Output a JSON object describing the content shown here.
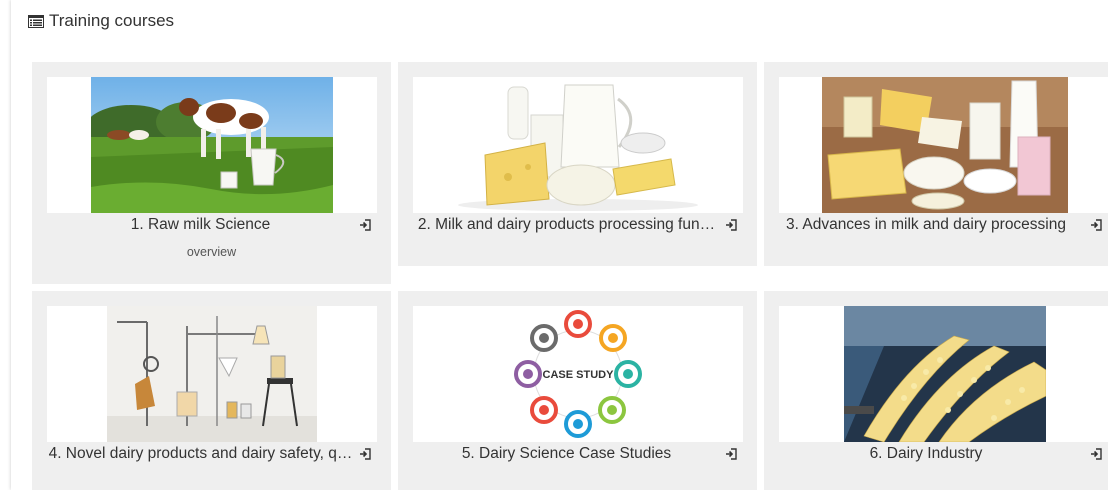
{
  "header": {
    "title": "Training courses",
    "icon": "list-icon"
  },
  "courses": [
    {
      "title": "1. Raw milk Science",
      "link": "overview"
    },
    {
      "title": "2. Milk and dairy products processing fun…"
    },
    {
      "title": "3. Advances in milk and dairy processing"
    },
    {
      "title": "4. Novel dairy products and dairy safety, q…"
    },
    {
      "title": "5. Dairy Science Case Studies"
    },
    {
      "title": "6. Dairy Industry"
    }
  ],
  "case_study": {
    "center_label": "CASE STUDY"
  },
  "colors": {
    "card_bg": "#efefef",
    "text": "#333333",
    "ring_colors": [
      "#e94b3c",
      "#f5a623",
      "#2bb3a3",
      "#8cc63f",
      "#1e9bd7",
      "#e94b3c",
      "#8e5ea2",
      "#6b6b6b"
    ]
  }
}
